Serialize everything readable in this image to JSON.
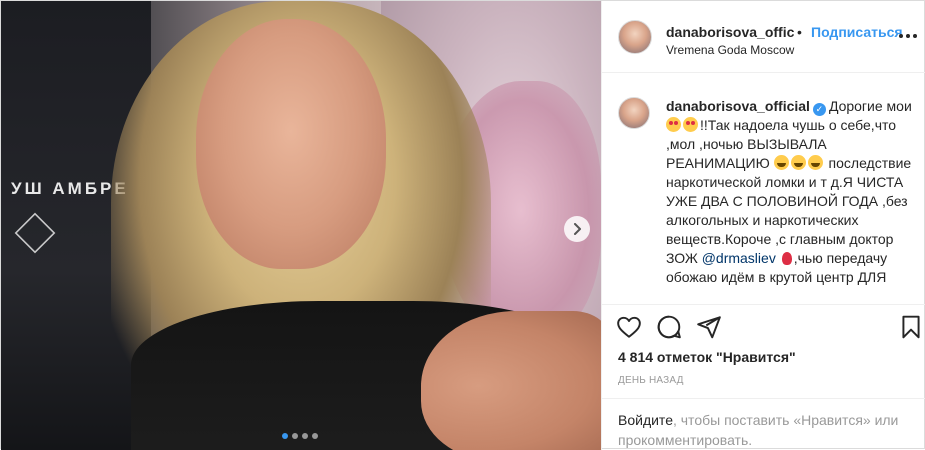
{
  "media": {
    "sign_text": "УШ АМБРЕ",
    "carousel_dots": 4,
    "active_dot": 0
  },
  "header": {
    "username": "danaborisova_offic",
    "separator": "•",
    "follow_label": "Подписаться",
    "location": "Vremena Goda Moscow"
  },
  "caption": {
    "username": "danaborisova_official",
    "text_1": "Дорогие мои ",
    "text_2": "!!Так надоела чушь о себе,что ,мол ,ночью ВЫЗЫВАЛА РЕАНИМАЦИЮ ",
    "text_3": " последствие наркотической ломки и т д.Я ЧИСТА УЖЕ ДВА С ПОЛОВИНОЙ ГОДА ,без алкогольных и наркотических веществ.Короче ,с главным доктор ЗОЖ ",
    "mention": "@drmasliev",
    "text_4": ",чью передачу обожаю идём в крутой центр ДЛЯ"
  },
  "likes": "4 814 отметок \"Нравится\"",
  "time": "день назад",
  "login_bar": {
    "login": "Войдите",
    "rest": ", чтобы поставить «Нравится» или прокомментировать."
  },
  "colors": {
    "accent": "#3897f0",
    "text": "#262626",
    "muted": "#999999",
    "border": "#efefef"
  },
  "icons": [
    "chevron-right-icon",
    "more-icon",
    "verified-icon",
    "heart-icon",
    "comment-icon",
    "share-icon",
    "bookmark-icon"
  ]
}
